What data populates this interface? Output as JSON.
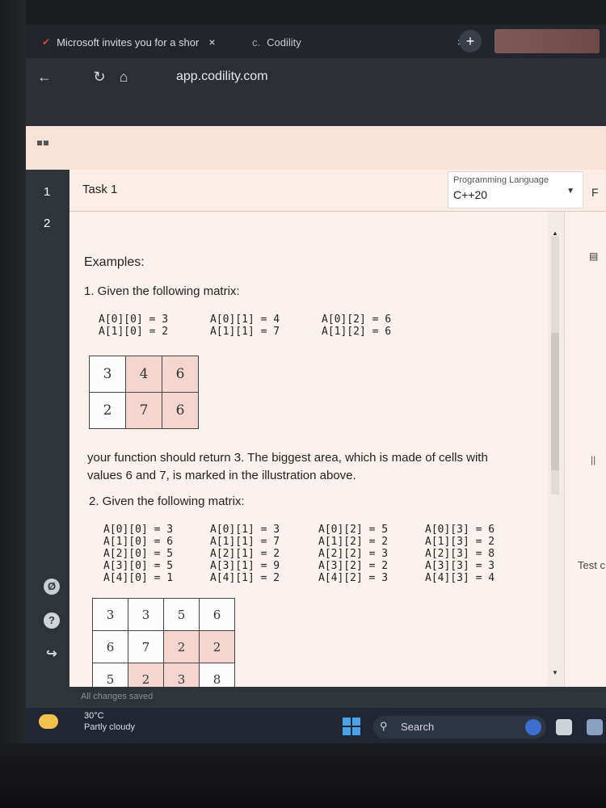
{
  "browser": {
    "tabs": [
      {
        "label": "Microsoft invites you for a shor",
        "close": "×"
      },
      {
        "label": "Codility",
        "close": "×"
      }
    ],
    "new_tab": "+",
    "url": "app.codility.com"
  },
  "rail": {
    "items": [
      "1",
      "2"
    ]
  },
  "task": {
    "title": "Task 1",
    "language_label": "Programming Language",
    "language_value": "C++20",
    "side_letter": "F"
  },
  "content": {
    "heading": "Examples:",
    "ex1_intro": "1. Given the following matrix:",
    "ex1_values": {
      "col0": "A[0][0] = 3\nA[1][0] = 2",
      "col1": "A[0][1] = 4\nA[1][1] = 7",
      "col2": "A[0][2] = 6\nA[1][2] = 6"
    },
    "ex1_grid": [
      [
        "3",
        "4",
        "6"
      ],
      [
        "2",
        "7",
        "6"
      ]
    ],
    "ex1_result_line1": "your function should return 3. The biggest area, which is made of cells with",
    "ex1_result_line2": "values 6 and 7, is marked in the illustration above.",
    "ex2_intro": "2. Given the following matrix:",
    "ex2_values": {
      "col0": "A[0][0] = 3\nA[1][0] = 6\nA[2][0] = 5\nA[3][0] = 5\nA[4][0] = 1",
      "col1": "A[0][1] = 3\nA[1][1] = 7\nA[2][1] = 2\nA[3][1] = 9\nA[4][1] = 2",
      "col2": "A[0][2] = 5\nA[1][2] = 2\nA[2][2] = 3\nA[3][2] = 2\nA[4][2] = 3",
      "col3": "A[0][3] = 6\nA[1][3] = 2\nA[2][3] = 8\nA[3][3] = 3\nA[4][3] = 4"
    },
    "ex2_grid": [
      [
        "3",
        "3",
        "5",
        "6"
      ],
      [
        "6",
        "7",
        "2",
        "2"
      ],
      [
        "5",
        "2",
        "3",
        "8"
      ]
    ]
  },
  "side_panel": {
    "label": "Test c",
    "handle": "||"
  },
  "status": {
    "saved": "All changes saved"
  },
  "taskbar": {
    "temperature": "30°C",
    "weather": "Partly cloudy",
    "search_label": "Search"
  },
  "colors": {
    "highlight": "#f4d5d0",
    "rail": "#2e3439",
    "header": "#f7e3d8"
  }
}
